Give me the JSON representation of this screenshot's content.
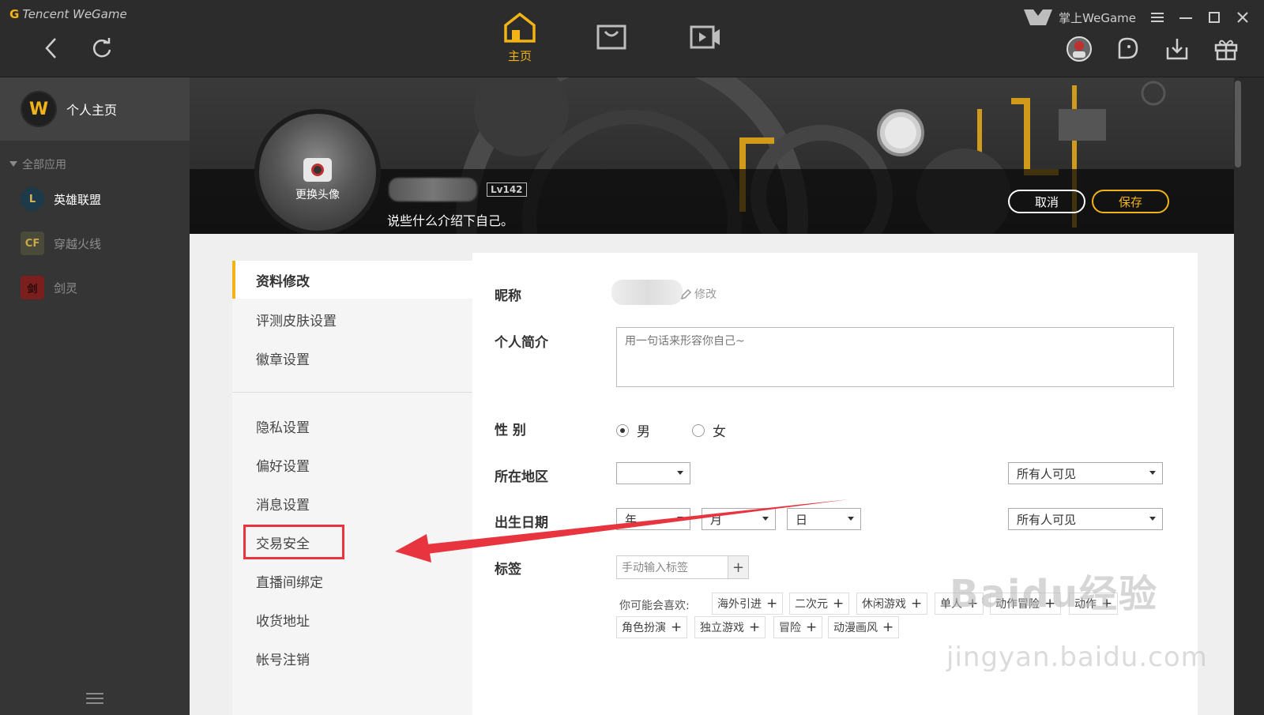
{
  "app": {
    "brand_prefix": "G",
    "brand": "Tencent WeGame"
  },
  "topnav": {
    "home_label": "主页"
  },
  "window": {
    "mobile_label": "掌上WeGame"
  },
  "sidebar": {
    "home_label": "个人主页",
    "logo_letter": "W",
    "group_label": "全部应用",
    "games": [
      {
        "label": "英雄联盟",
        "icon": "L"
      },
      {
        "label": "穿越火线",
        "icon": "CF"
      },
      {
        "label": "剑灵",
        "icon": "剑"
      }
    ]
  },
  "banner": {
    "avatar_label": "更换头像",
    "level": "Lv142",
    "intro": "说些什么介绍下自己。",
    "cancel_label": "取消",
    "save_label": "保存"
  },
  "menu": {
    "items": [
      "资料修改",
      "评测皮肤设置",
      "徽章设置",
      "隐私设置",
      "偏好设置",
      "消息设置",
      "交易安全",
      "直播间绑定",
      "收货地址",
      "帐号注销"
    ]
  },
  "form": {
    "nickname_label": "昵称",
    "edit_label": "修改",
    "bio_label": "个人简介",
    "bio_placeholder": "用一句话来形容你自己~",
    "gender_label": "性 别",
    "gender_male": "男",
    "gender_female": "女",
    "region_label": "所在地区",
    "region_value": "",
    "visibility_1": "所有人可见",
    "birth_label": "出生日期",
    "year": "年",
    "month": "月",
    "day": "日",
    "visibility_2": "所有人可见",
    "tags_label": "标签",
    "tag_placeholder": "手动输入标签",
    "suggest_label": "你可能会喜欢:",
    "tags_row1": [
      "海外引进",
      "二次元",
      "休闲游戏",
      "单人",
      "动作冒险",
      "动作"
    ],
    "tags_row2": [
      "角色扮演",
      "独立游戏",
      "冒险",
      "动漫画风"
    ]
  },
  "watermark": {
    "main": "Baidu经验",
    "sub": "jingyan.baidu.com"
  },
  "colors": {
    "accent": "#f2b318",
    "highlight": "#e8343f"
  }
}
